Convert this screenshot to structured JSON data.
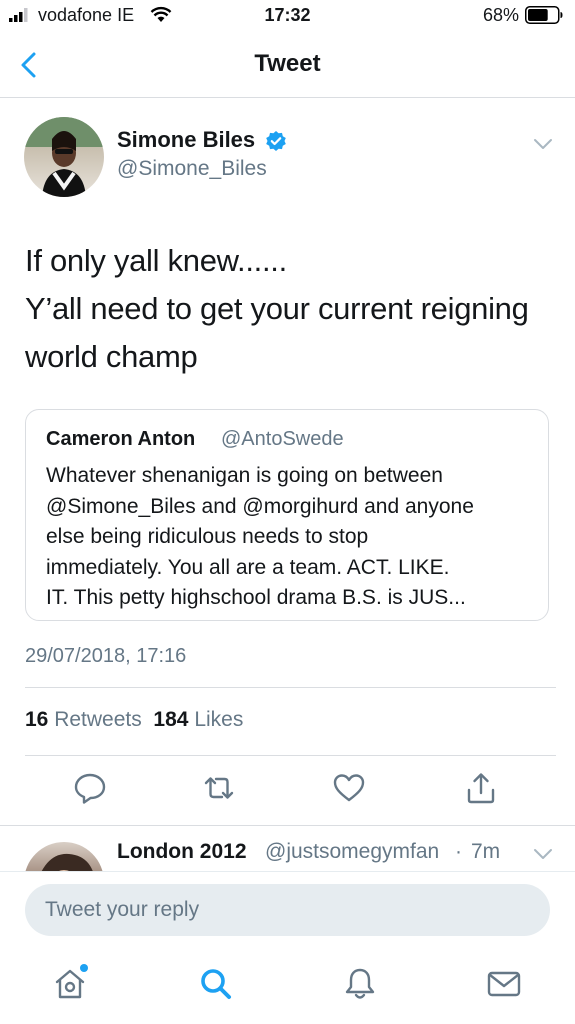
{
  "status_bar": {
    "carrier": "vodafone IE",
    "time": "17:32",
    "battery_percent": "68%",
    "battery_level": 0.68
  },
  "nav": {
    "title": "Tweet",
    "back_icon": "chevron-left-icon"
  },
  "tweet": {
    "author_name": "Simone Biles",
    "author_handle": "@Simone_Biles",
    "verified": true,
    "text_lines": [
      "If only yall knew......",
      "Y’all need to get your current reigning",
      "world champ"
    ],
    "quoted": {
      "name": "Cameron Anton",
      "handle": "@AntoSwede",
      "text_lines": [
        "Whatever shenanigan is going on between",
        "@Simone_Biles and @morgihurd and anyone",
        "else being ridiculous needs to stop",
        "immediately. You all are a team. ACT. LIKE.",
        "IT. This petty highschool drama B.S. is JUS..."
      ]
    },
    "timestamp": "29/07/2018, 17:16",
    "retweets_count": "16",
    "retweets_label": "Retweets",
    "likes_count": "184",
    "likes_label": "Likes",
    "actions": [
      "reply-icon",
      "retweet-icon",
      "like-icon",
      "share-icon"
    ]
  },
  "reply_preview": {
    "name": "London 2012",
    "handle": "@justsomegymfan",
    "separator": "·",
    "age": "7m"
  },
  "composer": {
    "placeholder": "Tweet your reply"
  },
  "tab_bar": {
    "items": [
      "home-icon",
      "search-icon",
      "notifications-icon",
      "messages-icon"
    ],
    "active_color": "#1da1f2"
  },
  "colors": {
    "accent": "#1da1f2",
    "text": "#14171a",
    "secondary_text": "#657786",
    "divider": "#dadde1"
  }
}
